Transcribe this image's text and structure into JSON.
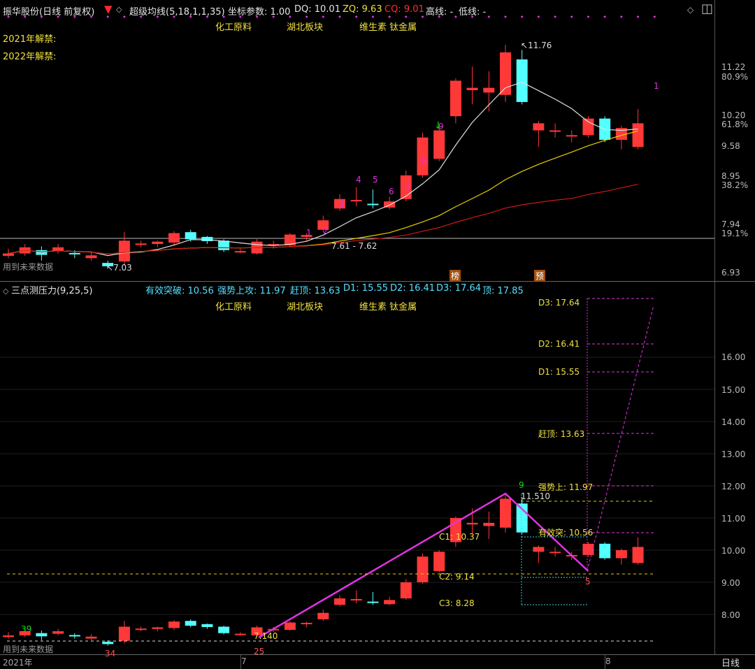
{
  "header": {
    "stock": "振华股份(日线 前复权)",
    "indicator": "超级均线(5,18,1,1,35)",
    "coord_label": "坐标参数: 1.00",
    "dq": "DQ: 10.01",
    "zq": "ZQ: 9.63",
    "cq": "CQ: 9.01",
    "high": "高线: -",
    "low": "低线: -"
  },
  "tags": [
    "化工原料",
    "湖北板块",
    "维生素 钛金属"
  ],
  "ban_2021": "2021年解禁:",
  "ban_2022": "2022年解禁:",
  "future_data": "用到未来数据",
  "top_axis": [
    "11.22",
    "80.9%",
    "10.20",
    "61.8%",
    "9.58",
    "8.95",
    "38.2%",
    "7.94",
    "19.1%",
    "6.93"
  ],
  "top_annot": {
    "high": "11.76",
    "low": "7.03",
    "mid": "7.61 - 7.62",
    "bang": "榜",
    "yu": "预"
  },
  "top_counts": [
    "1",
    "2",
    "3",
    "4",
    "5",
    "6",
    "7",
    "8",
    "9",
    "1"
  ],
  "lower": {
    "title": "三点测压力(9,25,5)",
    "eff": "有效突破: 10.56",
    "strong": "强势上攻: 11.97",
    "gan": "赶顶: 13.63",
    "d1": "D1: 15.55",
    "d2": "D2: 16.41",
    "d3": "D3: 17.64",
    "top": "顶: 17.85"
  },
  "lower_axis": [
    "16.00",
    "15.00",
    "14.00",
    "13.00",
    "12.00",
    "11.00",
    "10.00",
    "9.00",
    "8.00"
  ],
  "lower_labels": {
    "d3": "D3: 17.64",
    "d2": "D2: 16.41",
    "d1": "D1: 15.55",
    "gan": "赶顶: 13.63",
    "strong": "强势上: 11.97",
    "peak": "11.510",
    "eff": "有效突: 10.56",
    "c1": "C1: 10.37",
    "c2": "C2: 9.14",
    "c3": "C3: 8.28",
    "low": "7.140",
    "n9": "9",
    "n39": "39",
    "n34": "34",
    "n25": "25",
    "n5": "5"
  },
  "bottom": {
    "year": "2021年",
    "m7": "7",
    "m8": "8",
    "period": "日线"
  },
  "colors": {
    "up": "#ff3838",
    "down": "#54ffff",
    "ma_white": "#e0e0e0",
    "ma_yellow": "#e6d200",
    "ma_red": "#d01818",
    "magenta": "#e033e0"
  },
  "chart_data": {
    "type": "candlestick",
    "top_panel": {
      "ylim": [
        6.93,
        11.76
      ],
      "candles": [
        [
          7.3,
          7.35,
          7.45,
          7.25
        ],
        [
          7.35,
          7.48,
          7.55,
          7.3
        ],
        [
          7.42,
          7.32,
          7.5,
          7.2
        ],
        [
          7.4,
          7.48,
          7.55,
          7.35
        ],
        [
          7.36,
          7.33,
          7.42,
          7.25
        ],
        [
          7.25,
          7.31,
          7.38,
          7.2
        ],
        [
          7.15,
          7.08,
          7.2,
          7.03
        ],
        [
          7.18,
          7.62,
          7.8,
          7.1
        ],
        [
          7.55,
          7.56,
          7.62,
          7.48
        ],
        [
          7.55,
          7.6,
          7.62,
          7.48
        ],
        [
          7.58,
          7.78,
          7.82,
          7.52
        ],
        [
          7.8,
          7.65,
          7.85,
          7.6
        ],
        [
          7.7,
          7.61,
          7.72,
          7.55
        ],
        [
          7.62,
          7.42,
          7.65,
          7.38
        ],
        [
          7.4,
          7.4,
          7.45,
          7.35
        ],
        [
          7.35,
          7.6,
          7.65,
          7.33
        ],
        [
          7.55,
          7.55,
          7.62,
          7.45
        ],
        [
          7.52,
          7.75,
          7.78,
          7.5
        ],
        [
          7.7,
          7.74,
          7.78,
          7.6
        ],
        [
          7.85,
          8.05,
          8.15,
          7.8
        ],
        [
          8.3,
          8.5,
          8.6,
          8.25
        ],
        [
          8.45,
          8.48,
          8.75,
          8.35
        ],
        [
          8.4,
          8.38,
          8.7,
          8.3
        ],
        [
          8.32,
          8.45,
          8.55,
          8.28
        ],
        [
          8.5,
          9.0,
          9.1,
          8.45
        ],
        [
          9.0,
          9.8,
          9.9,
          8.95
        ],
        [
          9.35,
          9.95,
          10.0,
          9.3
        ],
        [
          10.25,
          11.0,
          11.05,
          10.1
        ],
        [
          10.8,
          10.85,
          11.3,
          10.5
        ],
        [
          10.75,
          10.85,
          11.2,
          10.35
        ],
        [
          10.7,
          11.6,
          11.76,
          10.55
        ],
        [
          11.45,
          10.55,
          11.65,
          10.5
        ],
        [
          9.95,
          10.1,
          10.15,
          9.6
        ],
        [
          9.95,
          9.95,
          10.1,
          9.8
        ],
        [
          9.83,
          9.85,
          9.95,
          9.7
        ],
        [
          9.85,
          10.2,
          10.25,
          9.8
        ],
        [
          10.2,
          9.75,
          10.25,
          9.7
        ],
        [
          9.75,
          10.0,
          10.05,
          9.55
        ],
        [
          9.6,
          10.1,
          10.4,
          9.55
        ]
      ]
    }
  }
}
